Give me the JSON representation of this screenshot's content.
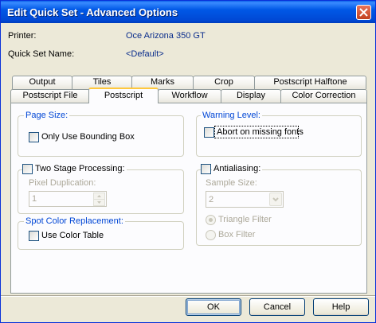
{
  "window": {
    "title": "Edit Quick Set - Advanced Options"
  },
  "info": {
    "printer_label": "Printer:",
    "printer_value": "Oce Arizona 350 GT",
    "quickset_label": "Quick Set Name:",
    "quickset_value": "<Default>"
  },
  "tabs_row1": [
    "Output",
    "Tiles",
    "Marks",
    "Crop",
    "Postscript Halftone"
  ],
  "tabs_row2": [
    "Postscript File",
    "Postscript",
    "Workflow",
    "Display",
    "Color Correction"
  ],
  "active_tab": "Postscript",
  "page_size": {
    "legend": "Page Size:",
    "checkbox_label": "Only Use Bounding Box",
    "checked": false
  },
  "warning_level": {
    "legend": "Warning Level:",
    "checkbox_label": "Abort on missing fonts",
    "checked": false
  },
  "two_stage": {
    "checkbox_label": "Two Stage Processing:",
    "checked": false,
    "pixel_dup_label": "Pixel Duplication:",
    "pixel_dup_value": "1"
  },
  "antialiasing": {
    "checkbox_label": "Antialiasing:",
    "checked": false,
    "sample_size_label": "Sample Size:",
    "sample_size_value": "2",
    "radio_triangle": "Triangle Filter",
    "radio_box": "Box Filter",
    "selected_filter": "Triangle Filter"
  },
  "spot_color": {
    "legend": "Spot Color Replacement:",
    "checkbox_label": "Use Color Table",
    "checked": false
  },
  "buttons": {
    "ok": "OK",
    "cancel": "Cancel",
    "help": "Help"
  },
  "colors": {
    "titlebar": "#0058e6",
    "accent_tab": "#ffc83c",
    "value_text": "#0a2d8c",
    "legend_text": "#0046d5"
  }
}
